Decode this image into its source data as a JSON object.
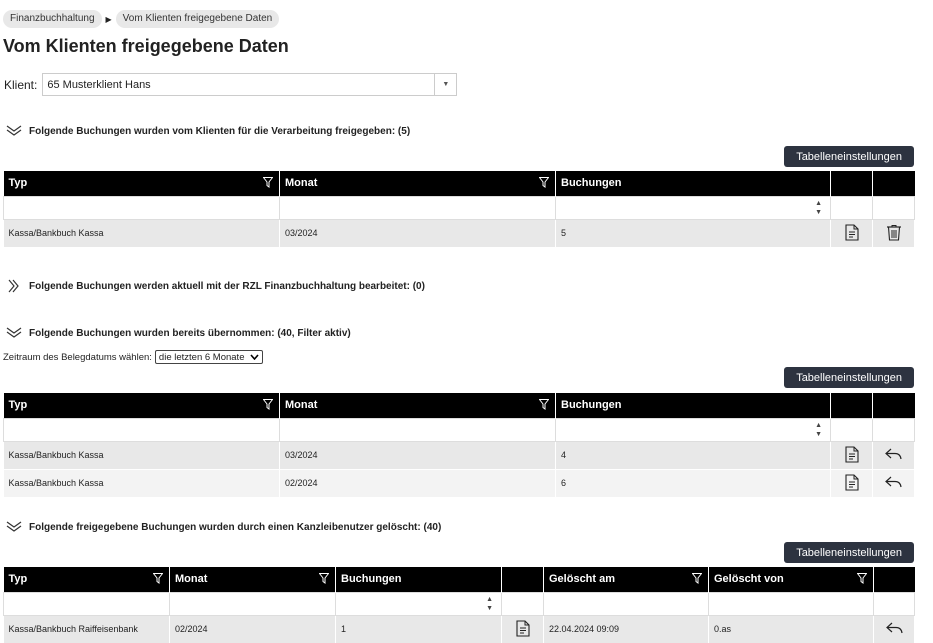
{
  "breadcrumb": [
    "Finanzbuchhaltung",
    "Vom Klienten freigegebene Daten"
  ],
  "title": "Vom Klienten freigegebene Daten",
  "client": {
    "label": "Klient:",
    "value": "65 Musterklient Hans"
  },
  "sections": {
    "s1": {
      "heading": "Folgende Buchungen wurden vom Klienten für die Verarbeitung freigegeben: (5)",
      "button": "Tabelleneinstellungen"
    },
    "s2": {
      "heading": "Folgende Buchungen werden aktuell mit der RZL Finanzbuchhaltung bearbeitet: (0)"
    },
    "s3": {
      "heading": "Folgende Buchungen wurden bereits übernommen: (40, Filter aktiv)",
      "button": "Tabelleneinstellungen",
      "period_label": "Zeitraum des Belegdatums wählen:",
      "period_value": "die letzten 6 Monate"
    },
    "s4": {
      "heading": "Folgende freigegebene Buchungen wurden durch einen Kanzleibenutzer gelöscht: (40)",
      "button": "Tabelleneinstellungen"
    }
  },
  "table1": {
    "headers": [
      "Typ",
      "Monat",
      "Buchungen"
    ],
    "rows": [
      {
        "typ": "Kassa/Bankbuch Kassa",
        "monat": "03/2024",
        "buchungen": "5"
      }
    ]
  },
  "table2": {
    "headers": [
      "Typ",
      "Monat",
      "Buchungen"
    ],
    "rows": [
      {
        "typ": "Kassa/Bankbuch Kassa",
        "monat": "03/2024",
        "buchungen": "4"
      },
      {
        "typ": "Kassa/Bankbuch Kassa",
        "monat": "02/2024",
        "buchungen": "6"
      }
    ]
  },
  "table3": {
    "headers": [
      "Typ",
      "Monat",
      "Buchungen",
      "Gelöscht am",
      "Gelöscht von"
    ],
    "rows": [
      {
        "typ": "Kassa/Bankbuch Raiffeisenbank",
        "monat": "02/2024",
        "buchungen": "1",
        "geloescht_am": "22.04.2024 09:09",
        "geloescht_von": "0.as"
      }
    ]
  },
  "icons": {
    "filter": "filter-icon",
    "document": "document-icon",
    "delete": "trash-icon",
    "revert": "reply-icon"
  }
}
